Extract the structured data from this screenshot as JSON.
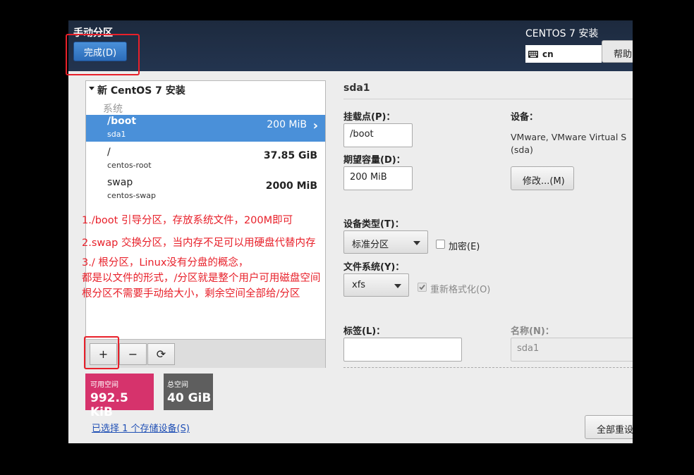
{
  "header": {
    "spoke_title": "手动分区",
    "done_button": "完成(D)",
    "product_title": "CENTOS 7 安装",
    "keyboard_layout": "cn",
    "help_button": "帮助"
  },
  "partitions": {
    "install_header": "新 CentOS 7 安装",
    "system_label": "系统",
    "rows": [
      {
        "mount": "/boot",
        "device": "sda1",
        "size": "200 MiB"
      },
      {
        "mount": "/",
        "device": "centos-root",
        "size": "37.85 GiB"
      },
      {
        "mount": "swap",
        "device": "centos-swap",
        "size": "2000 MiB"
      }
    ],
    "toolbar": {
      "add": "+",
      "remove": "−",
      "refresh": "⟳"
    }
  },
  "space": {
    "available_label": "可用空间",
    "available_value": "992.5 KiB",
    "total_label": "总空间",
    "total_value": "40 GiB"
  },
  "storage_link": "已选择 1 个存储设备(S)",
  "reset_button": "全部重设",
  "details": {
    "title": "sda1",
    "mount_point_label": "挂载点(P)：",
    "mount_point_value": "/boot",
    "desired_capacity_label": "期望容量(D)：",
    "desired_capacity_value": "200 MiB",
    "device_label": "设备：",
    "device_desc_line1": "VMware, VMware Virtual S",
    "device_desc_line2": "(sda)",
    "modify_button": "修改...(M)",
    "device_type_label": "设备类型(T)：",
    "device_type_value": "标准分区",
    "encrypt_label": "加密(E)",
    "filesystem_label": "文件系统(Y)：",
    "filesystem_value": "xfs",
    "reformat_label": "重新格式化(O)",
    "tag_label": "标签(L)：",
    "tag_value": "",
    "name_label": "名称(N)：",
    "name_value": "sda1"
  },
  "annotations": [
    "1./boot  引导分区，存放系统文件，200M即可",
    "2.swap 交换分区，当内存不足可以用硬盘代替内存",
    "3./ 根分区，Linux没有分盘的概念，",
    "都是以文件的形式，/分区就是整个用户可用磁盘空间",
    "根分区不需要手动给大小，剩余空间全部给/分区"
  ],
  "colors": {
    "accent": "#4a90d9",
    "annotation": "#e8202a",
    "available_space": "#d6336c",
    "total_space": "#5e5e5e"
  }
}
